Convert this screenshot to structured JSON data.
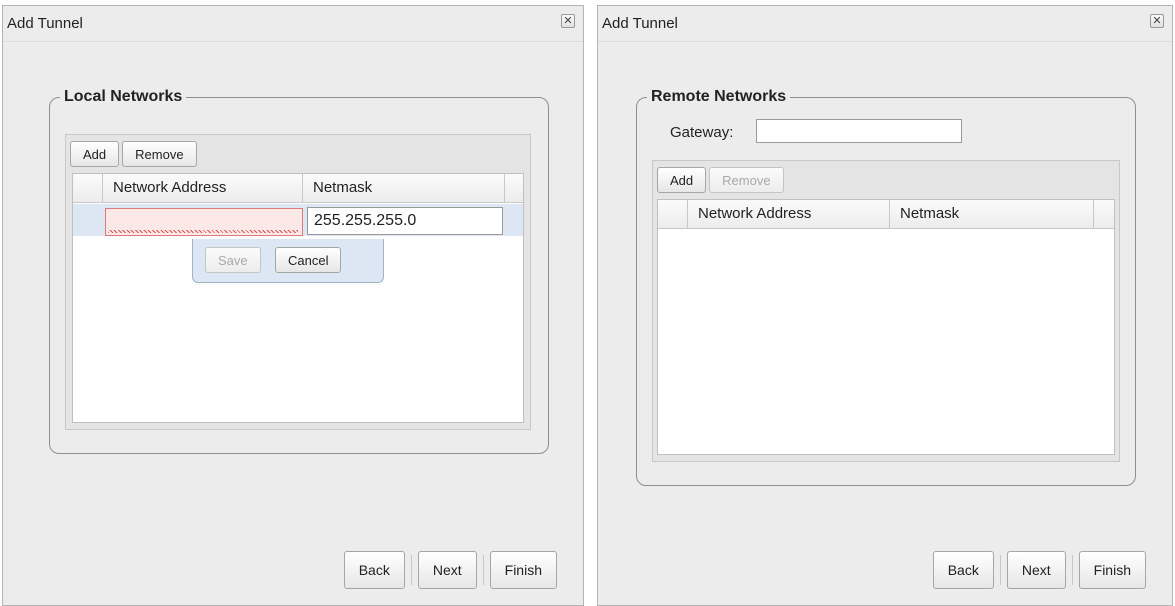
{
  "left": {
    "title": "Add Tunnel",
    "group_title": "Local Networks",
    "toolbar": {
      "add": "Add",
      "remove": "Remove"
    },
    "columns": [
      "Network Address",
      "Netmask"
    ],
    "edit_row": {
      "network_address": "",
      "netmask": "255.255.255.0"
    },
    "row_editor": {
      "save": "Save",
      "cancel": "Cancel"
    },
    "footer": {
      "back": "Back",
      "next": "Next",
      "finish": "Finish"
    }
  },
  "right": {
    "title": "Add Tunnel",
    "group_title": "Remote Networks",
    "gateway_label": "Gateway:",
    "gateway_value": "",
    "toolbar": {
      "add": "Add",
      "remove": "Remove"
    },
    "columns": [
      "Network Address",
      "Netmask"
    ],
    "footer": {
      "back": "Back",
      "next": "Next",
      "finish": "Finish"
    }
  },
  "icons": {
    "close": "close-icon"
  }
}
